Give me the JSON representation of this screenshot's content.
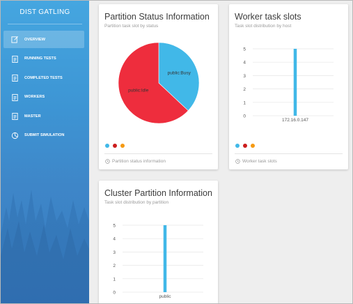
{
  "sidebar": {
    "brand": "DIST GATLING",
    "items": [
      {
        "label": "OVERVIEW",
        "icon": "edit-icon",
        "active": true
      },
      {
        "label": "RUNNING TESTS",
        "icon": "clipboard-icon",
        "active": false
      },
      {
        "label": "COMPLETED TESTS",
        "icon": "clipboard-icon",
        "active": false
      },
      {
        "label": "WORKERS",
        "icon": "clipboard-icon",
        "active": false
      },
      {
        "label": "MASTER",
        "icon": "clipboard-icon",
        "active": false
      },
      {
        "label": "SUBMIT SIMULATION",
        "icon": "pie-chart-icon",
        "active": false
      }
    ]
  },
  "colors": {
    "accent_blue": "#41b8e8",
    "red": "#ee2d3d",
    "dark_red": "#cc1d1d",
    "orange": "#f59a13"
  },
  "partition_status": {
    "title": "Partition Status Information",
    "subtitle": "Partition task slot by status",
    "footer": "Partition status information"
  },
  "worker_slots": {
    "title": "Worker task slots",
    "subtitle": "Task slot distribution by host",
    "footer": "Worker task slots"
  },
  "cluster_partition": {
    "title": "Cluster Partition Information",
    "subtitle": "Task slot distribution by partition"
  },
  "chart_data": [
    {
      "type": "pie",
      "labels": [
        "public:Busy",
        "public:Idle"
      ],
      "values": [
        37,
        63
      ],
      "colors": [
        "#41b8e8",
        "#ee2d3d"
      ]
    },
    {
      "type": "bar",
      "categories": [
        "172.16.0.147"
      ],
      "values": [
        5
      ],
      "ylim": [
        0,
        5
      ],
      "yticks": [
        0,
        1,
        2,
        3,
        4,
        5
      ],
      "grid": true,
      "color": "#41b8e8"
    },
    {
      "type": "bar",
      "categories": [
        "public"
      ],
      "values": [
        5
      ],
      "ylim": [
        0,
        5
      ],
      "yticks": [
        0,
        1,
        2,
        3,
        4,
        5
      ],
      "grid": true,
      "color": "#41b8e8"
    }
  ]
}
